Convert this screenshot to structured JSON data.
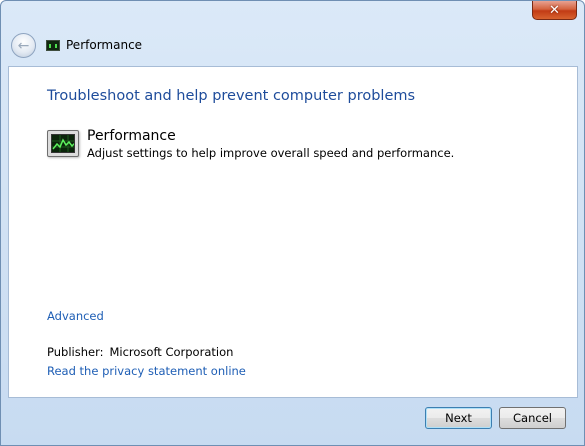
{
  "window": {
    "close_glyph": "✕"
  },
  "nav": {
    "back_icon": "back-arrow-icon",
    "title": "Performance"
  },
  "content": {
    "heading": "Troubleshoot and help prevent computer problems",
    "item": {
      "icon": "performance-monitor-icon",
      "title": "Performance",
      "description": "Adjust settings to help improve overall speed and performance."
    },
    "advanced_link": "Advanced",
    "publisher_label": "Publisher:",
    "publisher_value": "Microsoft Corporation",
    "privacy_link": "Read the privacy statement online"
  },
  "buttons": {
    "next": "Next",
    "cancel": "Cancel"
  },
  "colors": {
    "heading": "#1e4c9b",
    "link": "#1e5eb5",
    "frame": "#cfe0f3",
    "close": "#c23b15"
  }
}
